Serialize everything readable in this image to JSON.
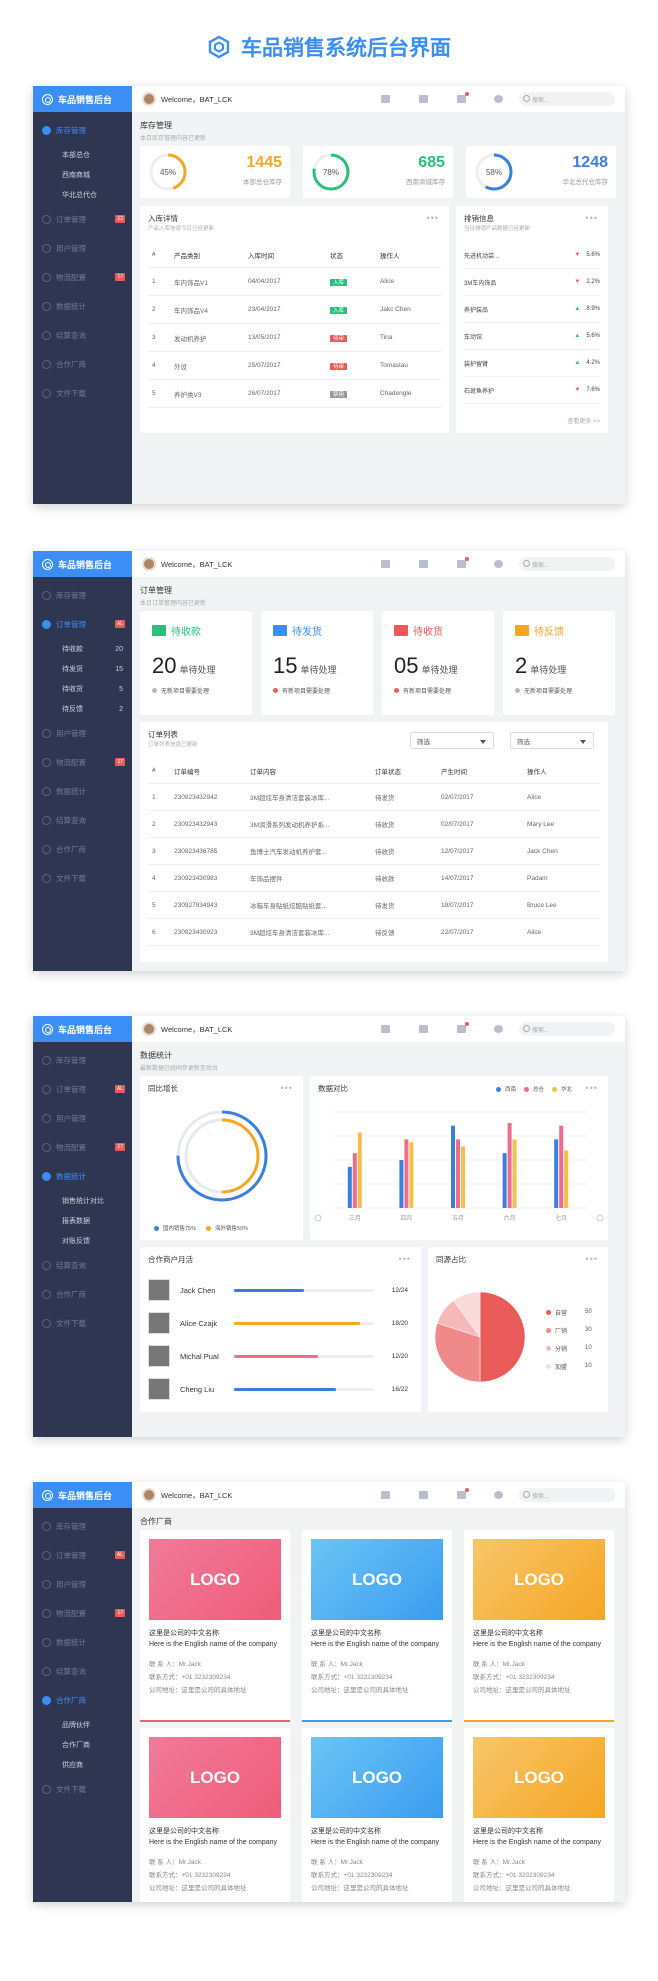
{
  "page_title": "车品销售系统后台界面",
  "brand": "车品销售后台",
  "welcome": "Welcome，BAT_LCK",
  "search_placeholder": "搜索...",
  "nav": {
    "inventory": "库存管理",
    "orders": "订单管理",
    "users": "用户管理",
    "logistics": "物流配置",
    "stats": "数据统计",
    "settlement": "结算查询",
    "partners": "合作厂商",
    "files": "文件下载"
  },
  "badges": {
    "orders_s1": "12",
    "logistics": "17",
    "orders": "AL"
  },
  "s1": {
    "subnav": [
      "本部总仓",
      "西南商城",
      "华北总代仓"
    ],
    "title": "库存管理",
    "subtitle": "本日库存管理内容已更新",
    "stats": [
      {
        "pct": "45%",
        "num": "1445",
        "label": "本部总仓库存",
        "color": "#f5a623",
        "frac": 0.45
      },
      {
        "pct": "78%",
        "num": "685",
        "label": "西南商城库存",
        "color": "#2bbf7b",
        "frac": 0.78
      },
      {
        "pct": "58%",
        "num": "1248",
        "label": "华北总代仓库存",
        "color": "#3a7fe0",
        "frac": 0.58
      }
    ],
    "detail_title": "入库详情",
    "detail_sub": "产品入库信息今日已经更新",
    "cols": [
      "#",
      "产品类别",
      "入库时间",
      "状态",
      "操作人"
    ],
    "rows": [
      [
        "1",
        "车内饰品V1",
        "04/04/2017",
        "入库",
        "Alice"
      ],
      [
        "2",
        "车内饰品V4",
        "23/04/2017",
        "入库",
        "Jakc Chen"
      ],
      [
        "3",
        "发动机养护",
        "13/05/2017",
        "待审",
        "Tina"
      ],
      [
        "4",
        "外设",
        "25/07/2017",
        "待审",
        "Tomaslau"
      ],
      [
        "5",
        "养护类V3",
        "26/07/2017",
        "禁用",
        "Chadengle"
      ]
    ],
    "tag_colors": [
      "#2bbf7b",
      "#2bbf7b",
      "#e95b5b",
      "#e95b5b",
      "#999999"
    ],
    "sales_title": "排销信息",
    "sales_sub": "当日排销产品数据已经更新",
    "sales": [
      [
        "先进机动袋...",
        "5.6%",
        "dn"
      ],
      [
        "3M车内饰品",
        "2.2%",
        "dn"
      ],
      [
        "养护装品",
        "8.9%",
        "up"
      ],
      [
        "车动馆",
        "5.6%",
        "up"
      ],
      [
        "装护留臂",
        "4.2%",
        "up"
      ],
      [
        "石斑鱼养护",
        "7.6%",
        "dn"
      ]
    ],
    "more_link": "查看更多 >>"
  },
  "s2": {
    "subnav": [
      [
        "待收款",
        "20"
      ],
      [
        "待发货",
        "15"
      ],
      [
        "待收货",
        "5"
      ],
      [
        "待反馈",
        "2"
      ]
    ],
    "title": "订单管理",
    "subtitle": "本日订单管理内容已更新",
    "cards": [
      {
        "title": "待收款",
        "num": "20",
        "unit": "单待处理",
        "foot": "无新项目需要处理",
        "color": "#2bbf7b",
        "dot": "#bbbbbb"
      },
      {
        "title": "待发货",
        "num": "15",
        "unit": "单待处理",
        "foot": "有新项目需要处理",
        "color": "#3a8ef6",
        "dot": "#e95b5b"
      },
      {
        "title": "待收货",
        "num": "05",
        "unit": "单待处理",
        "foot": "有新项目需要处理",
        "color": "#e95b5b",
        "dot": "#e95b5b"
      },
      {
        "title": "待反馈",
        "num": "2",
        "unit": "单待处理",
        "foot": "无新项目需要处理",
        "color": "#f5a623",
        "dot": "#bbbbbb"
      }
    ],
    "list_title": "订单列表",
    "list_sub": "订单列表信息已更新",
    "filter1": "筛选",
    "filter2": "筛选",
    "cols": [
      "#",
      "订单编号",
      "订单内容",
      "订单状态",
      "产生时间",
      "操作人"
    ],
    "rows": [
      [
        "1",
        "230923432942",
        "3M超炫车身清洁套装冰库...",
        "待发货",
        "02/07/2017",
        "Alice"
      ],
      [
        "2",
        "230923432943",
        "3M润滑系列发动机养护系...",
        "待收货",
        "02/07/2017",
        "Mary Lee"
      ],
      [
        "3",
        "230923436785",
        "鱼博士汽车发动机养护套...",
        "待收货",
        "12/07/2017",
        "Jack Chen"
      ],
      [
        "4",
        "230923430983",
        "车饰品摆件",
        "待收款",
        "14/07/2017",
        "Padam"
      ],
      [
        "5",
        "230927834943",
        "冰箱车身贴纸炫酷贴纸套...",
        "待发货",
        "19/07/2017",
        "Bruce Lee"
      ],
      [
        "6",
        "230923430923",
        "3M超炫车身清洁套装冰库...",
        "待反馈",
        "22/07/2017",
        "Alice"
      ]
    ]
  },
  "s3": {
    "subnav": [
      "销售统计对比",
      "报表数据",
      "对账反馈"
    ],
    "title": "数据统计",
    "subtitle": "最新数据已经同步更新至后台",
    "yoy_title": "同比增长",
    "yoy_legend": [
      "国内销售75%",
      "海外销售50%"
    ],
    "cmp_title": "数据对比",
    "cmp_legend": [
      "西南",
      "总仓",
      "华北"
    ],
    "part_title": "合作商户月活",
    "people": [
      [
        "Jack Chen",
        "12/24",
        0.5,
        "#3a7fe0"
      ],
      [
        "Alice Czajk",
        "18/20",
        0.9,
        "#f5a623"
      ],
      [
        "Michal Pual",
        "12/20",
        0.6,
        "#f06b8c"
      ],
      [
        "Cheng Liu",
        "16/22",
        0.73,
        "#3a7fe0"
      ]
    ],
    "pie_title": "同源占比",
    "pie_legend": [
      [
        "自营",
        "50",
        "#e95b5b"
      ],
      [
        "厂销",
        "30",
        "#f08a8a"
      ],
      [
        "分销",
        "10",
        "#f6b9b9"
      ],
      [
        "加盟",
        "10",
        "#fbdada"
      ]
    ]
  },
  "s4": {
    "subnav": [
      "品牌伙伴",
      "合作厂商",
      "供应商"
    ],
    "title": "合作厂商",
    "logo": "LOGO",
    "cn": "这里是公司的中文名称",
    "en": "Here is the English name of the company",
    "contact": "联 系 人：Mr.Jack",
    "phone": "联系方式：+01 3232309234",
    "addr": "公司地址：这里是公司的具体地址"
  },
  "chart_data": [
    {
      "type": "pie",
      "title": "同比增长",
      "categories": [
        "国内销售",
        "海外销售"
      ],
      "values": [
        75,
        50
      ]
    },
    {
      "type": "bar",
      "title": "数据对比",
      "categories": [
        "三月",
        "四月",
        "五月",
        "六月",
        "七月"
      ],
      "series": [
        {
          "name": "西南",
          "values": [
            30,
            35,
            60,
            40,
            50
          ]
        },
        {
          "name": "总仓",
          "values": [
            40,
            50,
            50,
            62,
            60
          ]
        },
        {
          "name": "华北",
          "values": [
            55,
            48,
            45,
            50,
            42
          ]
        }
      ],
      "ylim": [
        0,
        70
      ]
    },
    {
      "type": "pie",
      "title": "同源占比",
      "categories": [
        "自营",
        "厂销",
        "分销",
        "加盟"
      ],
      "values": [
        50,
        30,
        10,
        10
      ]
    }
  ]
}
